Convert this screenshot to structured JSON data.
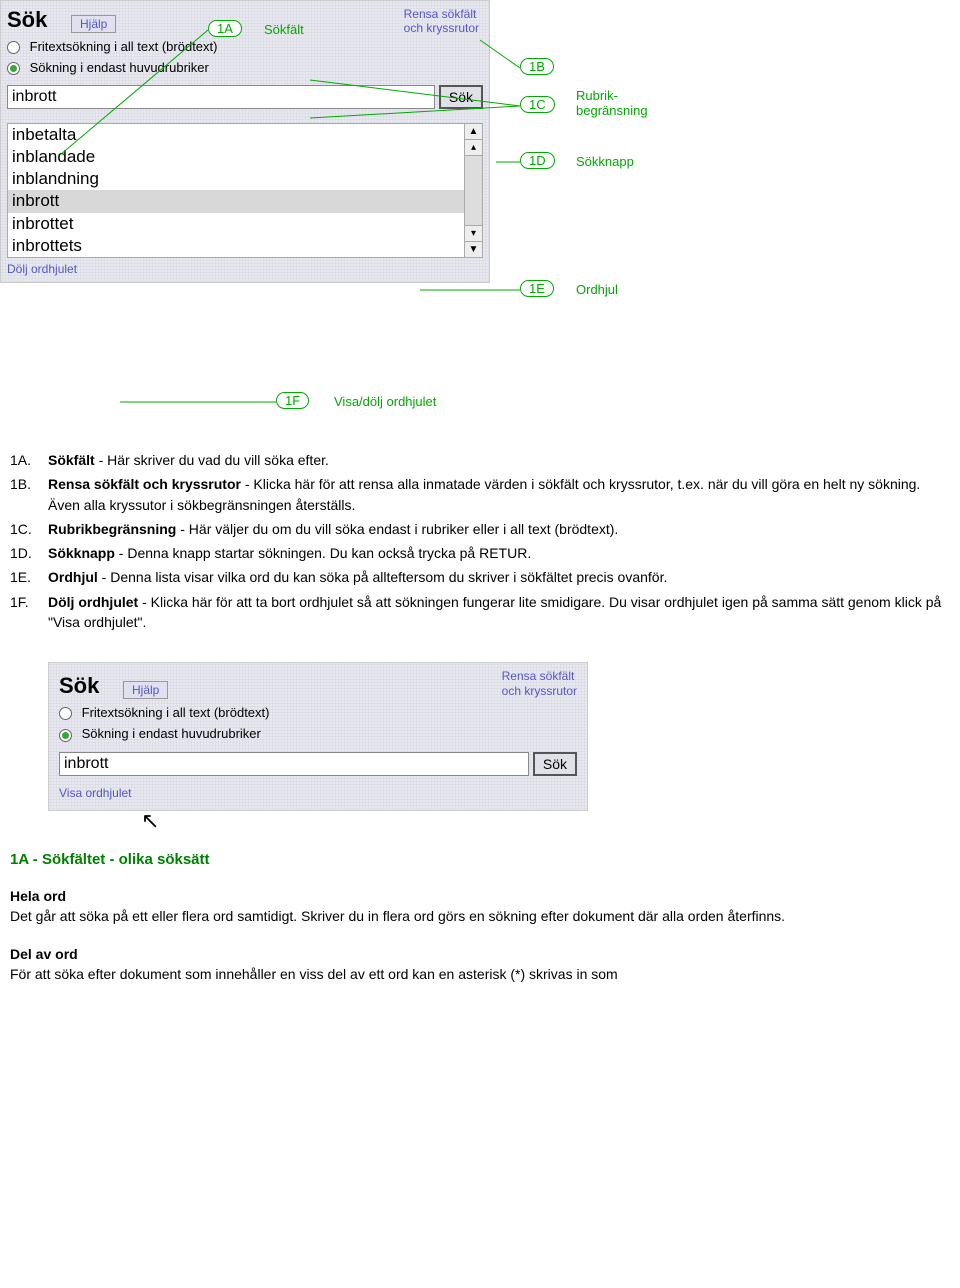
{
  "panel1": {
    "title": "Sök",
    "help": "Hjälp",
    "reset_line1": "Rensa sökfält",
    "reset_line2": "och kryssrutor",
    "radio1": "Fritextsökning i all text (brödtext)",
    "radio2": "Sökning i endast huvudrubriker",
    "search_value": "inbrott",
    "search_btn": "Sök",
    "wordwheel": [
      "inbetalta",
      "inblandade",
      "inblandning",
      "inbrott",
      "inbrottet",
      "inbrottets"
    ],
    "hide_link": "Dölj ordhjulet"
  },
  "callouts": {
    "c1a": "1A",
    "c1a_label": "Sökfält",
    "c1b": "1B",
    "c1c": "1C",
    "c1c_label1": "Rubrik-",
    "c1c_label2": "begränsning",
    "c1d": "1D",
    "c1d_label": "Sökknapp",
    "c1e": "1E",
    "c1e_label": "Ordhjul",
    "c1f": "1F",
    "c1f_label": "Visa/dölj ordhjulet"
  },
  "defs": [
    {
      "tag": "1A.",
      "term": "Sökfält",
      "text": " - Här skriver du vad du vill söka efter."
    },
    {
      "tag": "1B.",
      "term": "Rensa sökfält och kryssrutor",
      "text": " - Klicka här för att rensa alla inmatade värden i sökfält och kryssrutor, t.ex. när du vill göra en helt ny sökning. Även alla kryssutor i sökbegränsningen återställs."
    },
    {
      "tag": "1C.",
      "term": "Rubrikbegränsning",
      "text": " - Här väljer du om du vill söka endast i rubriker eller i all text (brödtext)."
    },
    {
      "tag": "1D.",
      "term": "Sökknapp",
      "text": " - Denna knapp startar sökningen. Du kan också trycka på RETUR."
    },
    {
      "tag": "1E.",
      "term": "Ordhjul",
      "text": " - Denna lista visar vilka ord du kan söka på allteftersom du skriver i sökfältet precis ovanför."
    },
    {
      "tag": "1F.",
      "term": "Dölj ordhjulet",
      "text": " - Klicka här för att ta bort ordhjulet så att sökningen fungerar lite smidigare. Du visar ordhjulet igen på samma sätt genom klick på \"Visa ordhjulet\"."
    }
  ],
  "panel2": {
    "title": "Sök",
    "help": "Hjälp",
    "reset_line1": "Rensa sökfält",
    "reset_line2": "och kryssrutor",
    "radio1": "Fritextsökning i all text (brödtext)",
    "radio2": "Sökning i endast huvudrubriker",
    "search_value": "inbrott",
    "search_btn": "Sök",
    "show_link": "Visa ordhjulet"
  },
  "section_title": "1A - Sökfältet - olika söksätt",
  "para1_h": "Hela ord",
  "para1_t": "Det går att söka på ett eller flera ord samtidigt. Skriver du in flera ord görs en sökning efter dokument där alla orden återfinns.",
  "para2_h": "Del av ord",
  "para2_t": "För att söka efter dokument som innehåller en viss del av ett ord kan en asterisk (*) skrivas in som"
}
